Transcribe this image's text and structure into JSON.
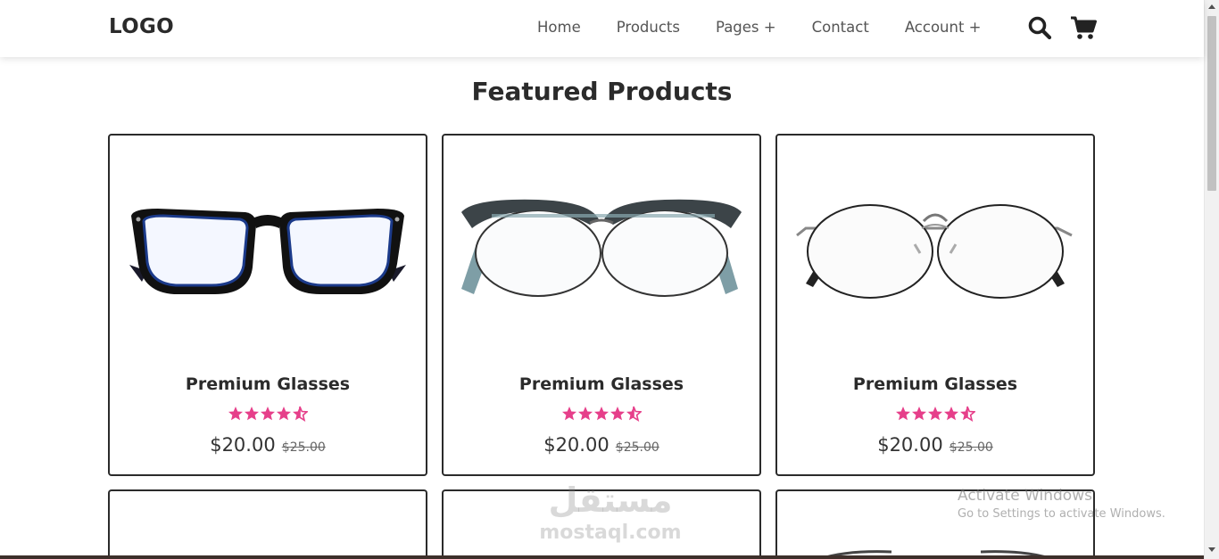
{
  "header": {
    "logo": "LOGO",
    "nav": [
      {
        "label": "Home"
      },
      {
        "label": "Products"
      },
      {
        "label": "Pages +"
      },
      {
        "label": "Contact"
      },
      {
        "label": "Account +"
      }
    ],
    "icons": [
      "search-icon",
      "cart-icon"
    ]
  },
  "section": {
    "title": "Featured Products"
  },
  "products": [
    {
      "name": "Premium Glasses",
      "rating": 4.5,
      "price": "$20.00",
      "old_price": "$25.00",
      "image": "black-rectangular-glasses"
    },
    {
      "name": "Premium Glasses",
      "rating": 4.5,
      "price": "$20.00",
      "old_price": "$25.00",
      "image": "browline-round-glasses"
    },
    {
      "name": "Premium Glasses",
      "rating": 4.5,
      "price": "$20.00",
      "old_price": "$25.00",
      "image": "wire-round-glasses"
    }
  ],
  "overlay": {
    "watermark_arabic": "مستقل",
    "watermark_latin": "mostaql.com",
    "activate_title": "Activate Windows",
    "activate_subtitle": "Go to Settings to activate Windows."
  },
  "colors": {
    "star": "#e63f8a",
    "card_border": "#2b2b2b",
    "text_dark": "#2b2b2b"
  }
}
